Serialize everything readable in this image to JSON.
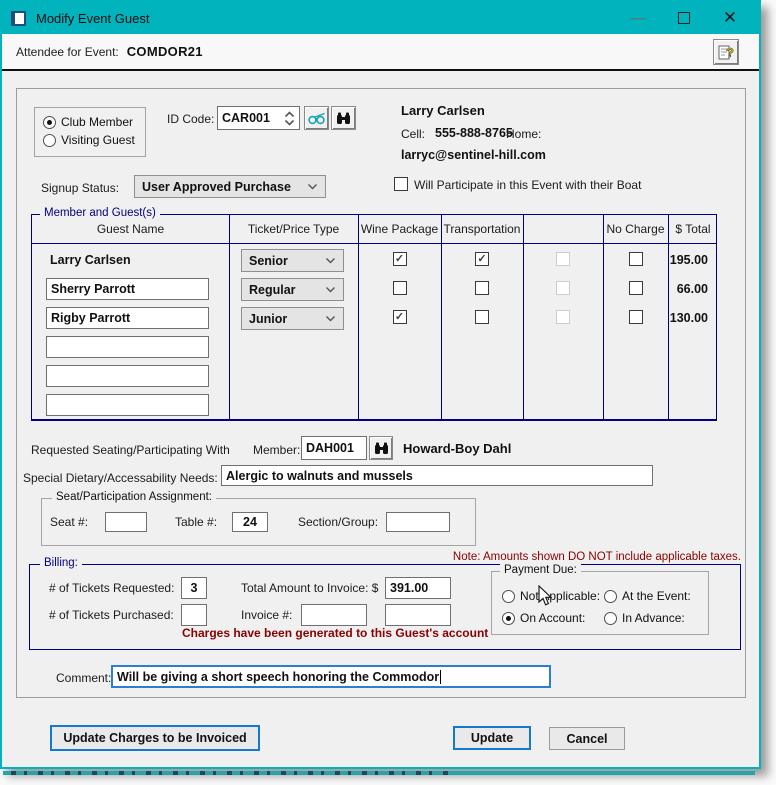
{
  "window": {
    "title": "Modify Event Guest"
  },
  "header": {
    "label": "Attendee for Event:",
    "value": "COMDOR21"
  },
  "member_type": {
    "options": [
      {
        "label": "Club Member",
        "selected": true
      },
      {
        "label": "Visiting Guest",
        "selected": false
      }
    ]
  },
  "id_code": {
    "label": "ID Code:",
    "value": "CAR001"
  },
  "contact": {
    "name": "Larry Carlsen",
    "cell_label": "Cell:",
    "cell": "555-888-8765",
    "home_label": "Home:",
    "email": "larryc@sentinel-hill.com"
  },
  "signup_status": {
    "label": "Signup Status:",
    "value": "User Approved Purchase"
  },
  "boat_checkbox": {
    "label": "Will Participate in this Event with their Boat",
    "checked": false
  },
  "guest_table": {
    "legend": "Member and Guest(s)",
    "columns": [
      "Guest Name",
      "Ticket/Price Type",
      "Wine Package",
      "Transportation",
      "",
      "No Charge",
      "$ Total"
    ],
    "rows": [
      {
        "name": "Larry Carlsen",
        "name_input": false,
        "ticket": "Senior",
        "wine": true,
        "transportation": true,
        "extra": "disabled",
        "no_charge": false,
        "total": "195.00"
      },
      {
        "name": "Sherry Parrott",
        "name_input": true,
        "ticket": "Regular",
        "wine": false,
        "transportation": false,
        "extra": "disabled",
        "no_charge": false,
        "total": "66.00"
      },
      {
        "name": "Rigby Parrott",
        "name_input": true,
        "ticket": "Junior",
        "wine": true,
        "transportation": false,
        "extra": "disabled",
        "no_charge": false,
        "total": "130.00"
      },
      {
        "name": "",
        "name_input": true,
        "ticket": null,
        "wine": null,
        "transportation": null,
        "extra": null,
        "no_charge": null,
        "total": ""
      },
      {
        "name": "",
        "name_input": true,
        "ticket": null,
        "wine": null,
        "transportation": null,
        "extra": null,
        "no_charge": null,
        "total": ""
      },
      {
        "name": "",
        "name_input": true,
        "ticket": null,
        "wine": null,
        "transportation": null,
        "extra": null,
        "no_charge": null,
        "total": ""
      }
    ]
  },
  "seating": {
    "label": "Requested Seating/Participating With",
    "member_label": "Member:",
    "member_code": "DAH001",
    "member_name": "Howard-Boy Dahl"
  },
  "dietary": {
    "label": "Special Dietary/Accessability Needs:",
    "value": "Alergic to walnuts and mussels"
  },
  "assignment": {
    "legend": "Seat/Participation Assignment:",
    "seat_label": "Seat #:",
    "seat": "",
    "table_label": "Table #:",
    "table": "24",
    "section_label": "Section/Group:",
    "section": ""
  },
  "note": "Note: Amounts shown DO NOT include applicable taxes.",
  "billing": {
    "legend": "Billing:",
    "tickets_requested_label": "# of Tickets Requested:",
    "tickets_requested": "3",
    "total_invoice_label": "Total Amount to Invoice: $",
    "total_invoice": "391.00",
    "tickets_purchased_label": "# of Tickets Purchased:",
    "tickets_purchased": "",
    "invoice_label": "Invoice #:",
    "invoice": "",
    "invoice2": "",
    "payment": {
      "legend": "Payment Due:",
      "options": [
        {
          "label": "Not Applicable:",
          "selected": false
        },
        {
          "label": "At the Event:",
          "selected": false
        },
        {
          "label": "On Account:",
          "selected": true
        },
        {
          "label": "In Advance:",
          "selected": false
        }
      ]
    },
    "message": "Charges have been generated to this Guest's account"
  },
  "comment": {
    "label": "Comment:",
    "value": "Will be giving a short speech honoring the Commodor"
  },
  "buttons": {
    "update_charges": "Update Charges to be Invoiced",
    "update": "Update",
    "cancel": "Cancel"
  },
  "colors": {
    "titlebar": "#00b3bd",
    "navy": "#000080",
    "maroon": "#8b0000",
    "button_blue": "#1279cc"
  }
}
